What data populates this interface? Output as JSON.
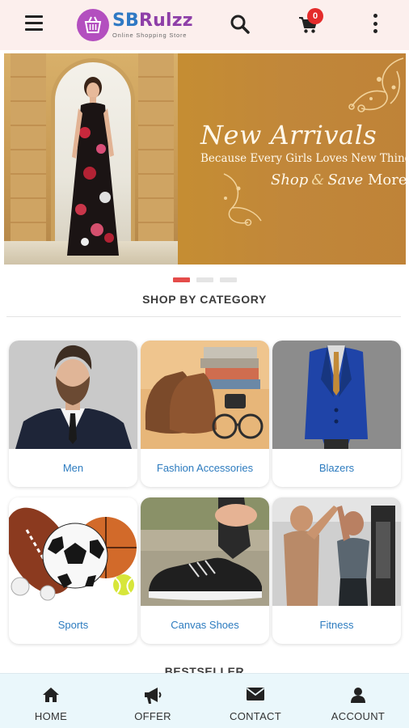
{
  "header": {
    "menu_icon": "hamburger-menu-icon",
    "logo": {
      "name_prefix": "SB",
      "name_rest": "Rulzz",
      "tagline": "Online Shopping Store",
      "icon": "shopping-basket-icon"
    },
    "search_icon": "search-icon",
    "cart": {
      "icon": "shopping-cart-icon",
      "count": "0"
    },
    "overflow_icon": "more-vertical-icon"
  },
  "banner": {
    "title": "New Arrivals",
    "subtitle": "Because Every Girls Loves New Things",
    "cta_shop": "Shop",
    "cta_amp": "&",
    "cta_save": "Save",
    "cta_more": "More",
    "slides_total": 3,
    "active_slide": 1
  },
  "categories": {
    "title": "SHOP BY CATEGORY",
    "items": [
      {
        "label": "Men"
      },
      {
        "label": "Fashion Accessories"
      },
      {
        "label": "Blazers"
      },
      {
        "label": "Sports"
      },
      {
        "label": "Canvas Shoes"
      },
      {
        "label": "Fitness"
      }
    ]
  },
  "next_section_title": "BESTSELLER",
  "bottom_nav": [
    {
      "label": "HOME",
      "icon": "home-icon"
    },
    {
      "label": "OFFER",
      "icon": "megaphone-icon"
    },
    {
      "label": "CONTACT",
      "icon": "envelope-icon"
    },
    {
      "label": "ACCOUNT",
      "icon": "user-icon"
    }
  ],
  "colors": {
    "header_bg": "#fcefed",
    "brand_purple": "#8e3fa8",
    "brand_blue": "#2f79c4",
    "badge_red": "#e42b2b",
    "link_blue": "#2c7bbf",
    "nav_bg": "#eaf7fb",
    "active_dot": "#e44c4a"
  }
}
